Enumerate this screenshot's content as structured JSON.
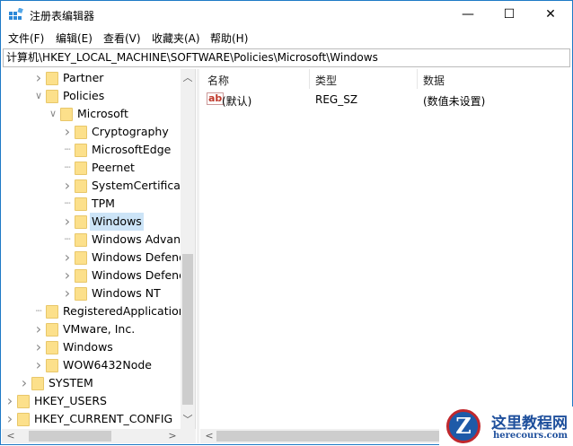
{
  "window": {
    "title": "注册表编辑器",
    "minimize": "—",
    "maximize": "☐",
    "close": "✕"
  },
  "menu": [
    "文件(F)",
    "编辑(E)",
    "查看(V)",
    "收藏夹(A)",
    "帮助(H)"
  ],
  "address": "计算机\\HKEY_LOCAL_MACHINE\\SOFTWARE\\Policies\\Microsoft\\Windows",
  "tree": [
    {
      "label": "Partner",
      "level": 2,
      "exp": "right"
    },
    {
      "label": "Policies",
      "level": 2,
      "exp": "down"
    },
    {
      "label": "Microsoft",
      "level": 3,
      "exp": "down"
    },
    {
      "label": "Cryptography",
      "level": 4,
      "exp": "right"
    },
    {
      "label": "MicrosoftEdge",
      "level": 4,
      "exp": "none"
    },
    {
      "label": "Peernet",
      "level": 4,
      "exp": "none"
    },
    {
      "label": "SystemCertificates",
      "level": 4,
      "exp": "right"
    },
    {
      "label": "TPM",
      "level": 4,
      "exp": "none"
    },
    {
      "label": "Windows",
      "level": 4,
      "exp": "right",
      "selected": true
    },
    {
      "label": "Windows Advanced Threat Protection",
      "level": 4,
      "exp": "none"
    },
    {
      "label": "Windows Defender",
      "level": 4,
      "exp": "right"
    },
    {
      "label": "Windows Defender Security Center",
      "level": 4,
      "exp": "right"
    },
    {
      "label": "Windows NT",
      "level": 4,
      "exp": "right"
    },
    {
      "label": "RegisteredApplications",
      "level": 2,
      "exp": "none"
    },
    {
      "label": "VMware, Inc.",
      "level": 2,
      "exp": "right"
    },
    {
      "label": "Windows",
      "level": 2,
      "exp": "right"
    },
    {
      "label": "WOW6432Node",
      "level": 2,
      "exp": "right"
    },
    {
      "label": "SYSTEM",
      "level": 1,
      "exp": "right"
    },
    {
      "label": "HKEY_USERS",
      "level": 0,
      "exp": "right"
    },
    {
      "label": "HKEY_CURRENT_CONFIG",
      "level": 0,
      "exp": "right"
    }
  ],
  "list": {
    "columns": [
      "名称",
      "类型",
      "数据"
    ],
    "rows": [
      {
        "name": "(默认)",
        "type": "REG_SZ",
        "data": "(数值未设置)",
        "icon": "ab"
      }
    ]
  },
  "watermark": {
    "name": "这里教程网",
    "url": "herecours.com"
  }
}
